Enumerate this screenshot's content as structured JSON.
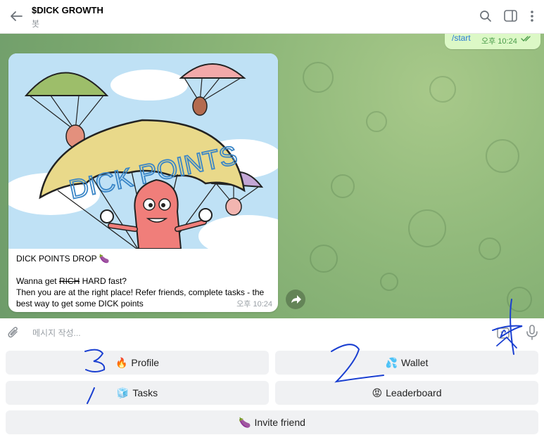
{
  "header": {
    "title": "$DICK GROWTH",
    "subtitle": "봇"
  },
  "chat": {
    "outgoing": {
      "text": "/start",
      "time": "오후 10:24"
    },
    "message": {
      "image_text": "DICK POINTS",
      "title": "DICK POINTS DROP 🍆",
      "line1_pre": "Wanna get ",
      "line1_strike": "RICH",
      "line1_post": " HARD fast?",
      "line2": "Then you are at the right place! Refer friends, complete tasks - the",
      "line3": "best way to get some DICK points",
      "time": "오후 10:24"
    }
  },
  "composer": {
    "placeholder": "메시지 작성..."
  },
  "keyboard": {
    "profile": {
      "emoji": "🔥",
      "label": "Profile"
    },
    "wallet": {
      "emoji": "💦",
      "label": "Wallet"
    },
    "tasks": {
      "emoji": "🧊",
      "label": "Tasks"
    },
    "leaderboard": {
      "emoji": "😡",
      "label": "Leaderboard"
    },
    "invite": {
      "emoji": "🍆",
      "label": "Invite friend"
    }
  },
  "annotations": [
    "3",
    "2",
    "1",
    "4"
  ],
  "colors": {
    "chat_bg": "#8fb87a",
    "outgoing_bubble": "#dcf8c6",
    "keyboard_button": "#f0f1f3",
    "annotation_ink": "#1a3fd1"
  }
}
